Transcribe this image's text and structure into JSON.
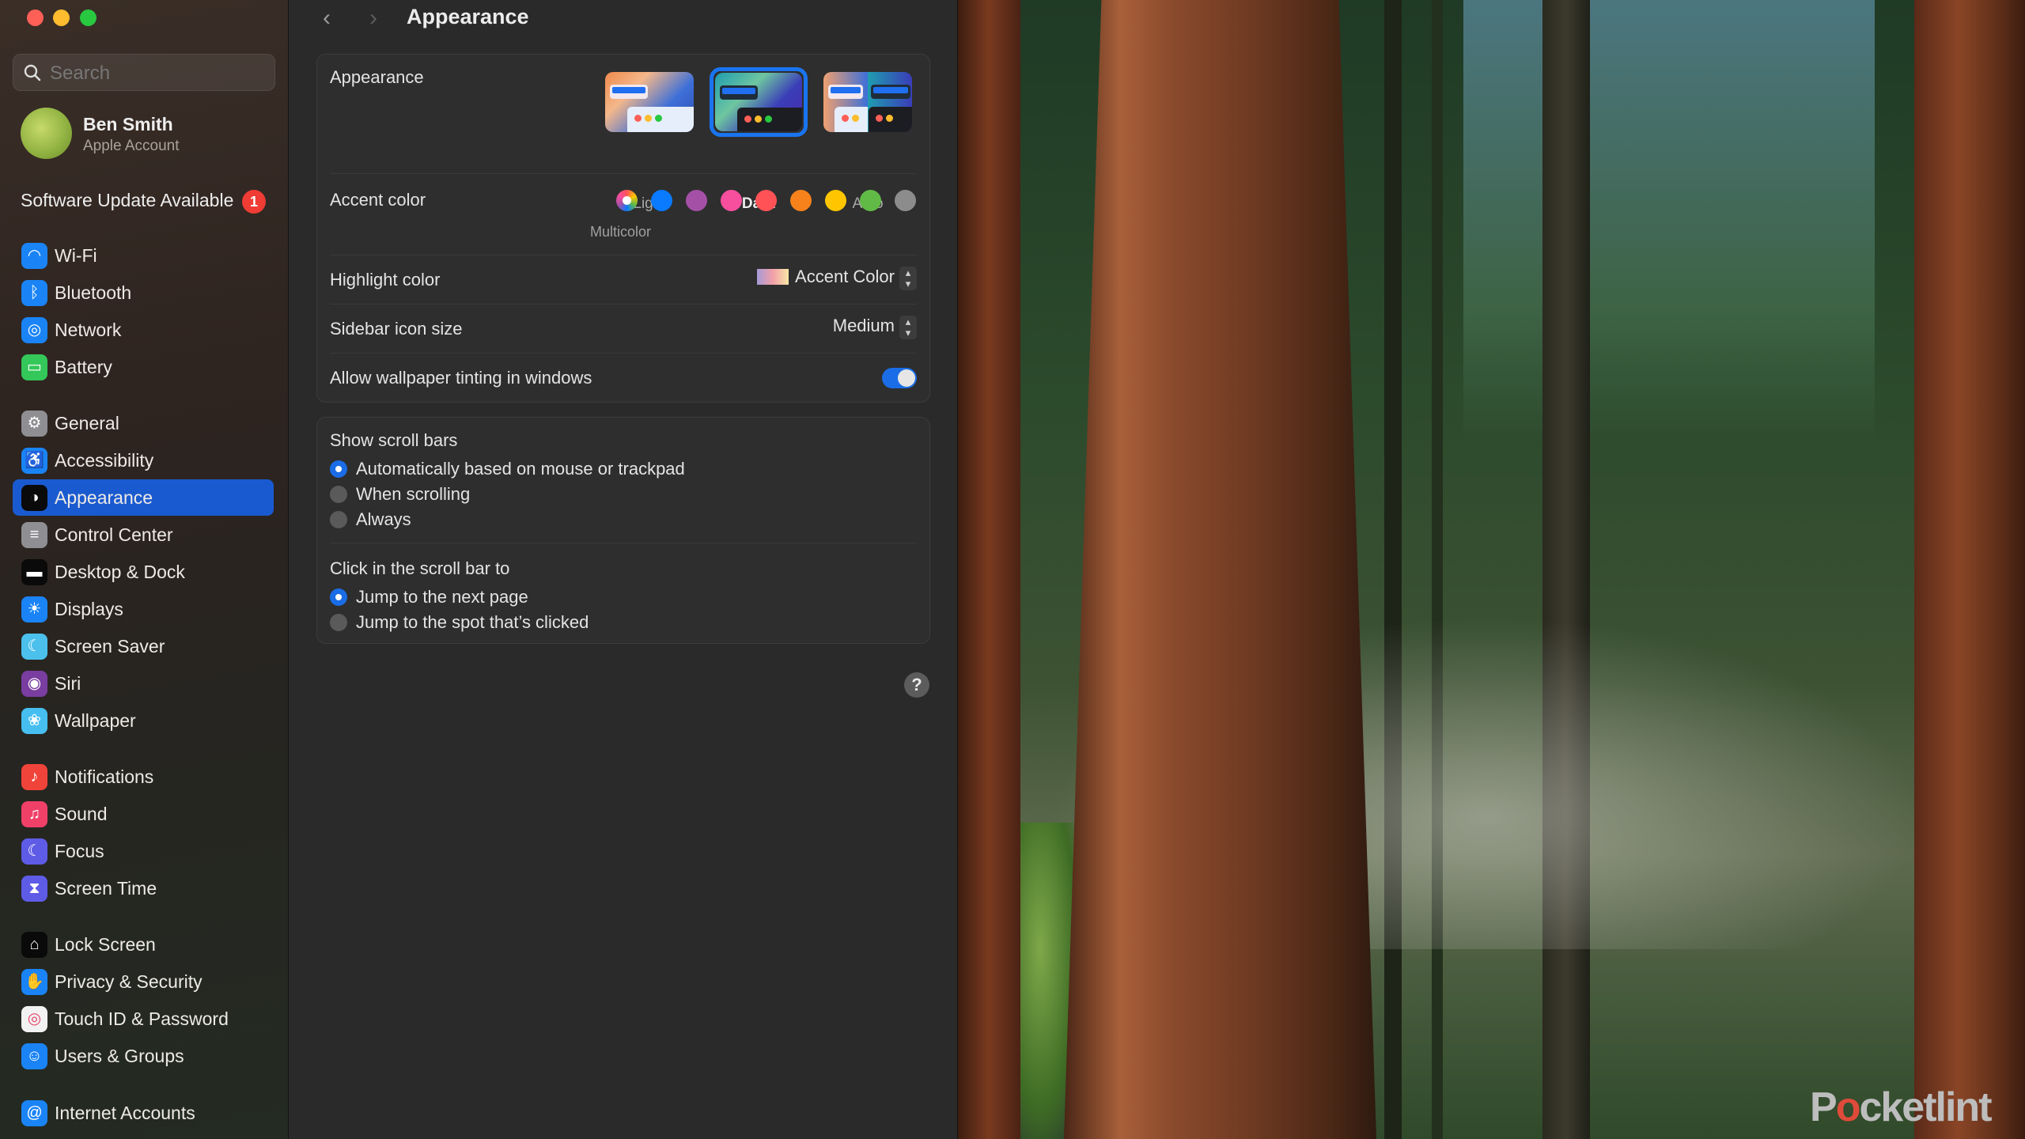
{
  "window": {
    "title": "Appearance",
    "traffic_lights": [
      "close",
      "minimize",
      "zoom"
    ]
  },
  "sidebar": {
    "search_placeholder": "Search",
    "account": {
      "name": "Ben Smith",
      "subtitle": "Apple Account"
    },
    "update": {
      "label": "Software Update Available",
      "badge": "1"
    },
    "items": [
      {
        "label": "Wi-Fi",
        "icon": "wifi-icon",
        "color": "#1a84f6"
      },
      {
        "label": "Bluetooth",
        "icon": "bluetooth-icon",
        "color": "#1a84f6"
      },
      {
        "label": "Network",
        "icon": "globe-icon",
        "color": "#1a84f6"
      },
      {
        "label": "Battery",
        "icon": "battery-icon",
        "color": "#34c759"
      },
      {
        "label": "General",
        "icon": "gear-icon",
        "color": "#8e8e93"
      },
      {
        "label": "Accessibility",
        "icon": "accessibility-icon",
        "color": "#1a84f6"
      },
      {
        "label": "Appearance",
        "icon": "appearance-icon",
        "color": "#0a0a0a",
        "active": true
      },
      {
        "label": "Control Center",
        "icon": "control-center-icon",
        "color": "#8e8e93"
      },
      {
        "label": "Desktop & Dock",
        "icon": "dock-icon",
        "color": "#0a0a0a"
      },
      {
        "label": "Displays",
        "icon": "sun-icon",
        "color": "#1a84f6"
      },
      {
        "label": "Screen Saver",
        "icon": "screen-saver-icon",
        "color": "#4cc0ec"
      },
      {
        "label": "Siri",
        "icon": "siri-icon",
        "color": "#7a3da0"
      },
      {
        "label": "Wallpaper",
        "icon": "wallpaper-icon",
        "color": "#46bff0"
      },
      {
        "label": "Notifications",
        "icon": "bell-icon",
        "color": "#f0443a"
      },
      {
        "label": "Sound",
        "icon": "speaker-icon",
        "color": "#f04068"
      },
      {
        "label": "Focus",
        "icon": "moon-icon",
        "color": "#5e5ce6"
      },
      {
        "label": "Screen Time",
        "icon": "hourglass-icon",
        "color": "#5e5ce6"
      },
      {
        "label": "Lock Screen",
        "icon": "lock-icon",
        "color": "#0a0a0a"
      },
      {
        "label": "Privacy & Security",
        "icon": "hand-icon",
        "color": "#1a84f6"
      },
      {
        "label": "Touch ID & Password",
        "icon": "fingerprint-icon",
        "color": "#f2f2f2"
      },
      {
        "label": "Users & Groups",
        "icon": "users-icon",
        "color": "#1a84f6"
      },
      {
        "label": "Internet Accounts",
        "icon": "at-icon",
        "color": "#1a84f6"
      }
    ]
  },
  "main": {
    "back_label": "‹",
    "forward_label": "›",
    "title": "Appearance",
    "appearance": {
      "label": "Appearance",
      "options": [
        {
          "label": "Light",
          "selected": false
        },
        {
          "label": "Dark",
          "selected": true
        },
        {
          "label": "Auto",
          "selected": false
        }
      ]
    },
    "accent": {
      "label": "Accent color",
      "selected_name": "Multicolor",
      "colors": [
        {
          "name": "Multicolor",
          "hex": "multicolor",
          "selected": true
        },
        {
          "name": "Blue",
          "hex": "#0a7aff",
          "selected": false
        },
        {
          "name": "Purple",
          "hex": "#a550a7",
          "selected": false
        },
        {
          "name": "Pink",
          "hex": "#f74f9e",
          "selected": false
        },
        {
          "name": "Red",
          "hex": "#ff5257",
          "selected": false
        },
        {
          "name": "Orange",
          "hex": "#f7821b",
          "selected": false
        },
        {
          "name": "Yellow",
          "hex": "#ffc600",
          "selected": false
        },
        {
          "name": "Green",
          "hex": "#62ba46",
          "selected": false
        },
        {
          "name": "Graphite",
          "hex": "#8c8c8c",
          "selected": false
        }
      ]
    },
    "highlight": {
      "label": "Highlight color",
      "value": "Accent Color"
    },
    "sidebar_icon_size": {
      "label": "Sidebar icon size",
      "value": "Medium"
    },
    "wallpaper_tinting": {
      "label": "Allow wallpaper tinting in windows",
      "enabled": true
    },
    "scroll_bars": {
      "label": "Show scroll bars",
      "options": [
        {
          "label": "Automatically based on mouse or trackpad",
          "selected": true
        },
        {
          "label": "When scrolling",
          "selected": false
        },
        {
          "label": "Always",
          "selected": false
        }
      ]
    },
    "click_scroll_bar": {
      "label": "Click in the scroll bar to",
      "options": [
        {
          "label": "Jump to the next page",
          "selected": true
        },
        {
          "label": "Jump to the spot that’s clicked",
          "selected": false
        }
      ]
    },
    "help_label": "?"
  },
  "watermark": {
    "text_pre": "P",
    "text_o": "o",
    "text_post": "cketlint"
  }
}
